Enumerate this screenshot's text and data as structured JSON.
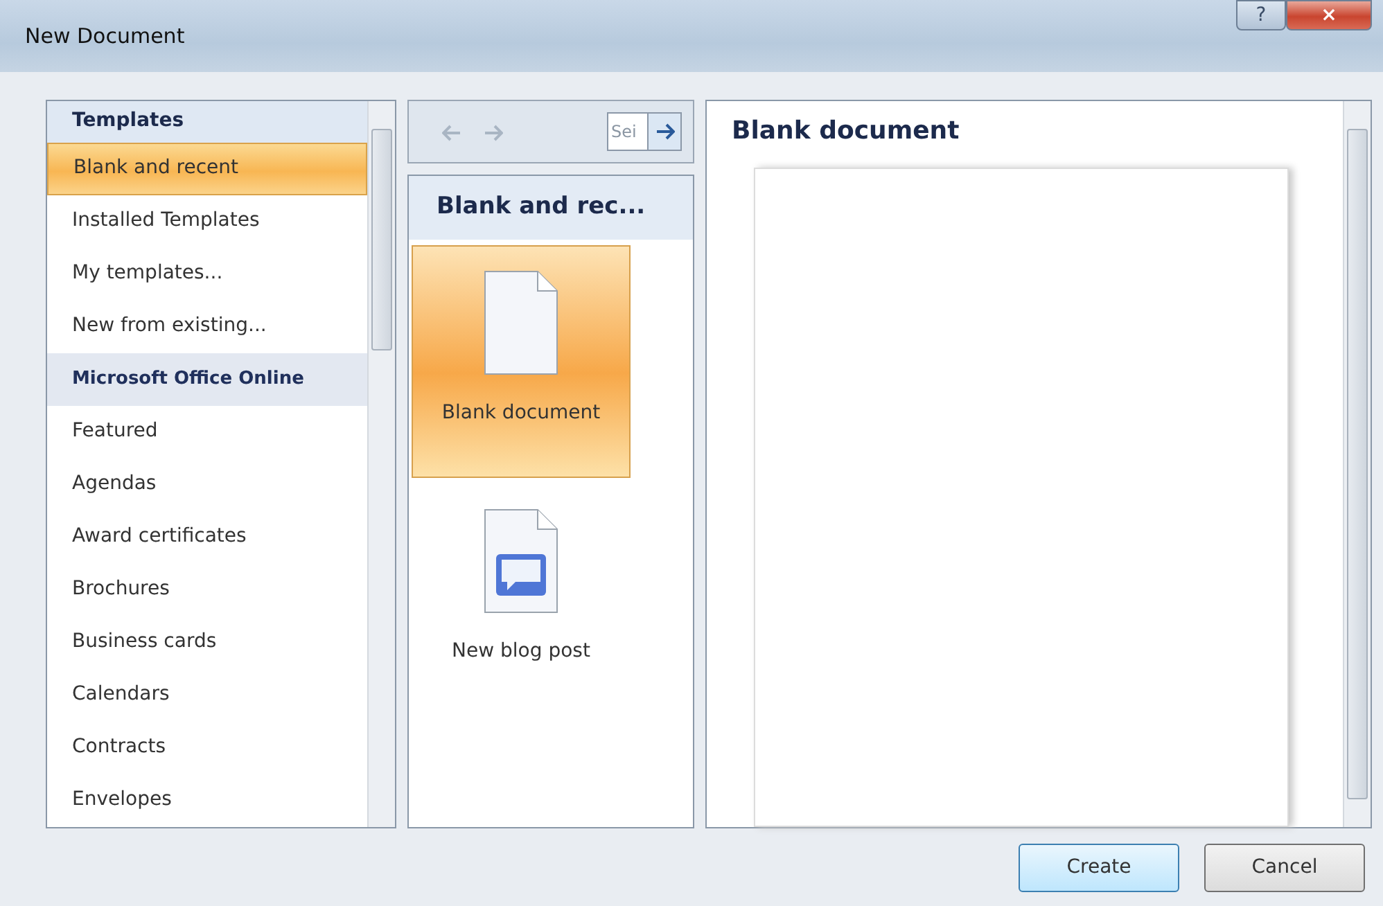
{
  "window": {
    "title": "New Document",
    "controls": [
      {
        "kind": "help",
        "label": "?"
      },
      {
        "kind": "close",
        "label": "×"
      }
    ]
  },
  "templates": {
    "title": "Templates",
    "items": [
      {
        "label": "Blank and recent",
        "kind": "item",
        "selected": true
      },
      {
        "label": "Installed Templates",
        "kind": "item",
        "selected": false
      },
      {
        "label": "My templates...",
        "kind": "item",
        "selected": false
      },
      {
        "label": "New from existing...",
        "kind": "item",
        "selected": false
      },
      {
        "label": "Microsoft Office Online",
        "kind": "section",
        "selected": false
      },
      {
        "label": "Featured",
        "kind": "item",
        "selected": false
      },
      {
        "label": "Agendas",
        "kind": "item",
        "selected": false
      },
      {
        "label": "Award certificates",
        "kind": "item",
        "selected": false
      },
      {
        "label": "Brochures",
        "kind": "item",
        "selected": false
      },
      {
        "label": "Business cards",
        "kind": "item",
        "selected": false
      },
      {
        "label": "Calendars",
        "kind": "item",
        "selected": false
      },
      {
        "label": "Contracts",
        "kind": "item",
        "selected": false
      },
      {
        "label": "Envelopes",
        "kind": "item",
        "selected": false
      }
    ]
  },
  "search": {
    "placeholder": "Sei"
  },
  "gallery": {
    "title": "Blank and rec...",
    "items": [
      {
        "label": "Blank document",
        "kind": "blank",
        "selected": true
      },
      {
        "label": "New blog post",
        "kind": "blog",
        "selected": false
      }
    ]
  },
  "preview": {
    "title": "Blank document"
  },
  "buttons": [
    {
      "label": "Create",
      "default": true
    },
    {
      "label": "Cancel",
      "default": false
    }
  ]
}
